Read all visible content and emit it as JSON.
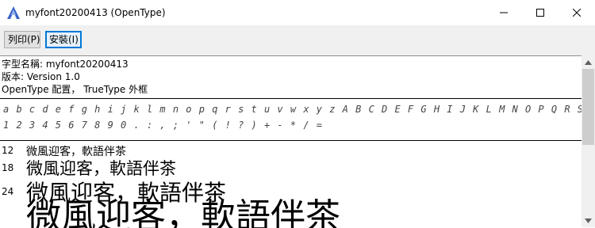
{
  "window": {
    "title": "myfont20200413 (OpenType)",
    "icon": "font-file-icon"
  },
  "toolbar": {
    "print_label": "列印(P)",
    "install_label": "安裝(I)"
  },
  "info": {
    "font_name_line": "字型名稱: myfont20200413",
    "version_line": "版本: Version 1.0",
    "outline_line": "OpenType 配置， TrueType 外框"
  },
  "charset": {
    "line1": "a b c d e f g h i j k l m n o p q r s t u v w x y z    A B C D E F G H I J K L M N O P Q R S T U V W X Y Z",
    "line2": "1 2 3 4 5 6 7 8 9 0 . : ,  ;   '  \"    ( ! ? )    + - * / ="
  },
  "samples": [
    {
      "size": "12",
      "text": "微風迎客，軟語伴茶"
    },
    {
      "size": "18",
      "text": "微風迎客，軟語伴茶"
    },
    {
      "size": "24",
      "text": "微風迎客，軟語伴茶"
    },
    {
      "size": "",
      "text": "微風迎客，軟語伴茶"
    }
  ],
  "colors": {
    "accent": "#0078d7",
    "toolbar_bg": "#f0f0f0"
  }
}
